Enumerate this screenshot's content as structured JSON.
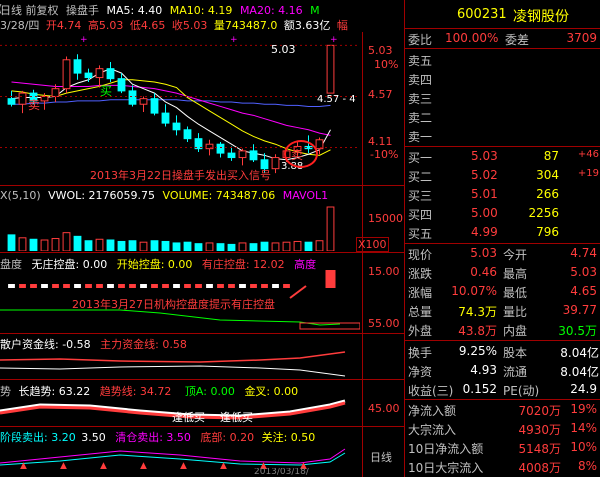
{
  "colors": {
    "up": "#ff3c3c",
    "down": "#00ffff",
    "yellow": "#ffff00",
    "white": "#ffffff",
    "magenta": "#ff00ff",
    "green": "#00ff00",
    "blue": "#5060ff",
    "grid": "#a00000",
    "label": "#c0c0c0"
  },
  "header": {
    "line1": {
      "period": "日线 前复权",
      "indicator": "操盘手",
      "ma5": "MA5: 4.40",
      "ma10": "MA10: 4.19",
      "ma20": "MA20: 4.16",
      "mark": "M"
    },
    "line2": {
      "date": "3/28/四",
      "open": "开4.74",
      "high": "高5.03",
      "low": "低4.65",
      "close": "收5.03",
      "volume": "量743487.0",
      "amount": "额3.63亿",
      "mark": "幅"
    }
  },
  "main_panel": {
    "price_axis": [
      {
        "label": "5.03",
        "color": "#ff3c3c"
      },
      {
        "label": "10%",
        "color": "#ff3c3c"
      },
      {
        "label": "4.57",
        "color": "#ff3c3c"
      },
      {
        "label": "4.11",
        "color": "#ff3c3c"
      },
      {
        "label": "-10%",
        "color": "#ff3c3c"
      }
    ],
    "annotations": {
      "high": "5.03",
      "midlabel": "4.57 - 4",
      "low": "3.88",
      "sell1": "卖",
      "buy1": "买",
      "sell2": "卖",
      "note": "2013年3月22日操盘手发出买入信号"
    }
  },
  "chart_data": {
    "type": "candlestick",
    "ohlc": [
      [
        4.55,
        4.62,
        4.48,
        4.5
      ],
      [
        4.5,
        4.62,
        4.42,
        4.6
      ],
      [
        4.6,
        4.63,
        4.5,
        4.53
      ],
      [
        4.53,
        4.6,
        4.45,
        4.57
      ],
      [
        4.57,
        4.68,
        4.52,
        4.64
      ],
      [
        4.64,
        4.93,
        4.6,
        4.9
      ],
      [
        4.9,
        4.95,
        4.72,
        4.78
      ],
      [
        4.78,
        4.82,
        4.7,
        4.74
      ],
      [
        4.74,
        4.85,
        4.65,
        4.82
      ],
      [
        4.82,
        4.88,
        4.7,
        4.73
      ],
      [
        4.73,
        4.78,
        4.6,
        4.62
      ],
      [
        4.62,
        4.67,
        4.48,
        4.5
      ],
      [
        4.5,
        4.57,
        4.43,
        4.55
      ],
      [
        4.55,
        4.6,
        4.4,
        4.42
      ],
      [
        4.42,
        4.5,
        4.3,
        4.33
      ],
      [
        4.33,
        4.4,
        4.22,
        4.27
      ],
      [
        4.27,
        4.3,
        4.16,
        4.19
      ],
      [
        4.19,
        4.24,
        4.07,
        4.1
      ],
      [
        4.1,
        4.18,
        4.04,
        4.14
      ],
      [
        4.14,
        4.16,
        4.02,
        4.06
      ],
      [
        4.06,
        4.12,
        3.99,
        4.02
      ],
      [
        4.02,
        4.1,
        3.95,
        4.08
      ],
      [
        4.08,
        4.14,
        3.98,
        4.0
      ],
      [
        4.0,
        4.06,
        3.88,
        3.92
      ],
      [
        3.92,
        4.05,
        3.88,
        4.02
      ],
      [
        4.02,
        4.1,
        3.98,
        4.08
      ],
      [
        4.08,
        4.16,
        4.04,
        4.12
      ],
      [
        4.12,
        4.22,
        4.06,
        4.1
      ],
      [
        4.1,
        4.2,
        4.05,
        4.18
      ],
      [
        4.6,
        5.03,
        4.6,
        5.03
      ]
    ],
    "ma5": [
      4.55,
      4.56,
      4.56,
      4.56,
      4.57,
      4.65,
      4.69,
      4.72,
      4.78,
      4.82,
      4.78,
      4.68,
      4.64,
      4.6,
      4.52,
      4.47,
      4.39,
      4.32,
      4.26,
      4.2,
      4.14,
      4.08,
      4.06,
      4.04,
      4.01,
      4.0,
      4.02,
      4.05,
      4.09,
      4.27
    ],
    "ma10": [
      4.62,
      4.61,
      4.59,
      4.58,
      4.57,
      4.6,
      4.62,
      4.64,
      4.66,
      4.69,
      4.72,
      4.72,
      4.71,
      4.7,
      4.68,
      4.65,
      4.56,
      4.5,
      4.44,
      4.38,
      4.32,
      4.26,
      4.21,
      4.17,
      4.14,
      4.1,
      4.07,
      4.05,
      4.04,
      4.09
    ],
    "ma20": [
      4.7,
      4.69,
      4.68,
      4.67,
      4.66,
      4.66,
      4.66,
      4.66,
      4.67,
      4.67,
      4.67,
      4.66,
      4.65,
      4.64,
      4.62,
      4.6,
      4.57,
      4.54,
      4.51,
      4.48,
      4.45,
      4.42,
      4.4,
      4.37,
      4.34,
      4.31,
      4.29,
      4.27,
      4.24,
      4.22
    ],
    "ma60": [
      4.5,
      4.5,
      4.51,
      4.51,
      4.52,
      4.52,
      4.53,
      4.53,
      4.53,
      4.54,
      4.54,
      4.54,
      4.54,
      4.54,
      4.54,
      4.54,
      4.53,
      4.53,
      4.53,
      4.52,
      4.52,
      4.51,
      4.51,
      4.5,
      4.5,
      4.49,
      4.49,
      4.48,
      4.48,
      4.49
    ],
    "ylim": [
      3.8,
      5.15
    ]
  },
  "volume_panel": {
    "title": "X(5,10)",
    "vwol": "VWOL: 2176059.75",
    "volume": "VOLUME: 743487.06",
    "mavol": "MAVOL1",
    "axis": "15000",
    "unit": "X100",
    "values": [
      22,
      18,
      16,
      15,
      17,
      25,
      20,
      14,
      16,
      15,
      13,
      14,
      12,
      14,
      13,
      11,
      12,
      10,
      11,
      10,
      9,
      11,
      10,
      12,
      11,
      12,
      13,
      12,
      14,
      60
    ]
  },
  "control_panel": {
    "label": "盘度",
    "wu": "无庄控盘: 0.00",
    "kaishi": "开始控盘: 0.00",
    "youzhuang": "有庄控盘: 12.02",
    "gaodu": "高度",
    "axis1": "15.00",
    "axis2": "55.00",
    "note": "2013年3月27日机构控盘度提示有庄控盘"
  },
  "fund_panel": {
    "label": "散户资金线: -0.58",
    "main": "主力资金线: 0.58"
  },
  "trend_panel": {
    "label": "势",
    "long": "长趋势: 63.22",
    "short": "趋势线: 34.72",
    "top": "顶A: 0.00",
    "gold": "金叉: 0.00",
    "axis": "45.00",
    "sig1": "逢低买",
    "sig2": "逢低买"
  },
  "stage_panel": {
    "sell": "阶段卖出: 3.20",
    "val": "3.50",
    "clear": "清仓卖出: 3.50",
    "bottom": "底部: 0.20",
    "focus": "关注: 0.50",
    "axis": "日线",
    "date": "2013/03/18/"
  },
  "quote": {
    "code": "600231",
    "name": "凌钢股份",
    "weibi_label": "委比",
    "weibi": "100.00%",
    "weicha_label": "委差",
    "weicha": "3709",
    "asks": [
      {
        "label": "卖五"
      },
      {
        "label": "卖四"
      },
      {
        "label": "卖三"
      },
      {
        "label": "卖二"
      },
      {
        "label": "卖一"
      }
    ],
    "bids": [
      {
        "label": "买一",
        "price": "5.03",
        "vol": "87",
        "chg": "+46"
      },
      {
        "label": "买二",
        "price": "5.02",
        "vol": "304",
        "chg": "+19"
      },
      {
        "label": "买三",
        "price": "5.01",
        "vol": "266",
        "chg": ""
      },
      {
        "label": "买四",
        "price": "5.00",
        "vol": "2256",
        "chg": ""
      },
      {
        "label": "买五",
        "price": "4.99",
        "vol": "796",
        "chg": ""
      }
    ],
    "stats": [
      {
        "l1": "现价",
        "v1": "5.03",
        "c1": "#ff3c3c",
        "l2": "今开",
        "v2": "4.74",
        "c2": "#ff3c3c"
      },
      {
        "l1": "涨跌",
        "v1": "0.46",
        "c1": "#ff3c3c",
        "l2": "最高",
        "v2": "5.03",
        "c2": "#ff3c3c"
      },
      {
        "l1": "涨幅",
        "v1": "10.07%",
        "c1": "#ff3c3c",
        "l2": "最低",
        "v2": "4.65",
        "c2": "#ff3c3c"
      },
      {
        "l1": "总量",
        "v1": "74.3万",
        "c1": "#ffff00",
        "l2": "量比",
        "v2": "39.77",
        "c2": "#ff3c3c"
      },
      {
        "l1": "外盘",
        "v1": "43.8万",
        "c1": "#ff3c3c",
        "l2": "内盘",
        "v2": "30.5万",
        "c2": "#00ff00"
      }
    ],
    "stats2": [
      {
        "l1": "换手",
        "v1": "9.25%",
        "l2": "股本",
        "v2": "8.04亿"
      },
      {
        "l1": "净资",
        "v1": "4.93",
        "l2": "流通",
        "v2": "8.04亿"
      },
      {
        "l1": "收益(三)",
        "v1": "0.152",
        "l2": "PE(动)",
        "v2": "24.9"
      }
    ],
    "flows": [
      {
        "label": "净流入额",
        "val": "7020万",
        "pct": "19%"
      },
      {
        "label": "大宗流入",
        "val": "4930万",
        "pct": "14%"
      },
      {
        "label": "10日净流入额",
        "val": "5148万",
        "pct": "10%"
      },
      {
        "label": "10日大宗流入",
        "val": "4008万",
        "pct": "8%"
      }
    ]
  }
}
